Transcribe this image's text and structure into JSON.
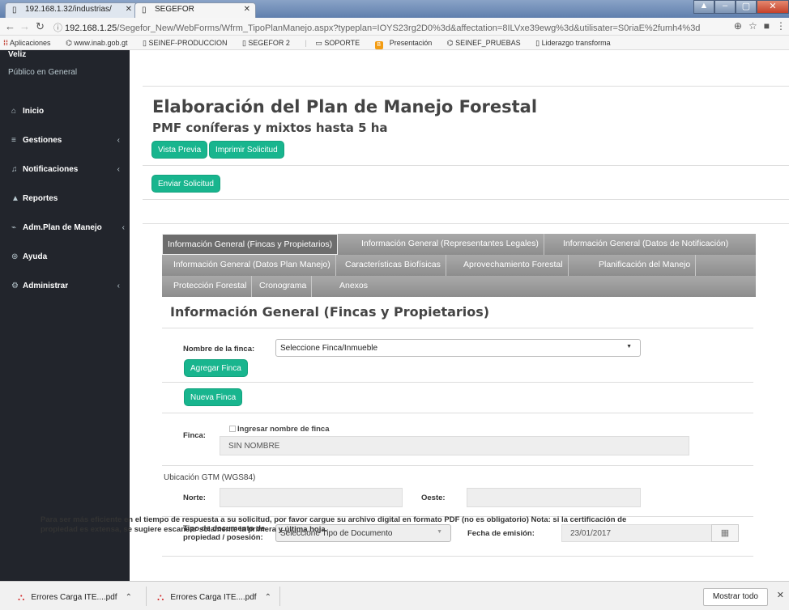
{
  "browser": {
    "tabs": [
      {
        "title": "192.168.1.32/industrias/",
        "active": false
      },
      {
        "title": "SEGEFOR",
        "active": true
      }
    ],
    "url": {
      "host": "192.168.1.25",
      "path": "/Segefor_New/WebForms/Wfrm_TipoPlanManejo.aspx?typeplan=IOYS23rg2D0%3d&affectation=8ILVxe39ewg%3d&utilisater=S0riaE%2fumh4%3d"
    },
    "bookmarks": [
      "Aplicaciones",
      "www.inab.gob.gt",
      "SEINEF-PRODUCCION",
      "SEGEFOR 2",
      "SOPORTE",
      "Presentación",
      "SEINEF_PRUEBAS",
      "Liderazgo transforma"
    ]
  },
  "sidebar": {
    "user_name": "Veliz",
    "user_role": "Público en General",
    "items": [
      {
        "label": "Inicio",
        "icon": "home-icon",
        "glyph": "⌂",
        "submenu": false
      },
      {
        "label": "Gestiones",
        "icon": "list-icon",
        "glyph": "≡",
        "submenu": true
      },
      {
        "label": "Notificaciones",
        "icon": "bell-icon",
        "glyph": "♫",
        "submenu": true
      },
      {
        "label": "Reportes",
        "icon": "print-icon",
        "glyph": "▲",
        "submenu": false
      },
      {
        "label": "Adm.Plan de Manejo",
        "icon": "chart-icon",
        "glyph": "⌁",
        "submenu": true
      },
      {
        "label": "Ayuda",
        "icon": "help-icon",
        "glyph": "⊛",
        "submenu": false
      },
      {
        "label": "Administrar",
        "icon": "settings-icon",
        "glyph": "⚙",
        "submenu": true
      }
    ],
    "chevron": "‹"
  },
  "main": {
    "title": "Elaboración del Plan de Manejo Forestal",
    "subtitle": "PMF coníferas y mixtos hasta 5 ha",
    "btn_preview": "Vista Previa",
    "btn_print": "Imprimir Solicitud",
    "btn_send": "Enviar Solicitud",
    "tabs_row1": [
      "Información General (Fincas y Propietarios)",
      "Información General (Representantes Legales)",
      "Información General (Datos de Notificación)"
    ],
    "tabs_row2": [
      "Información General (Datos Plan Manejo)",
      "Características Biofísicas",
      "Aprovechamiento Forestal",
      "Planificación del Manejo"
    ],
    "tabs_row3": [
      "Protección Forestal",
      "Cronograma",
      "Anexos"
    ],
    "section_title": "Información General (Fincas y Propietarios)",
    "finca_label": "Nombre de la finca:",
    "finca_select": "Seleccione Finca/Inmueble",
    "btn_add_finca": "Agregar Finca",
    "btn_new_finca": "Nueva Finca",
    "finca_field_label": "Finca:",
    "finca_checkbox_label": "Ingresar nombre de finca",
    "finca_value": "SIN NOMBRE",
    "gtm_label": "Ubicación GTM (WGS84)",
    "norte_label": "Norte:",
    "oeste_label": "Oeste:",
    "tipo_doc_label": "Tipo de documento de propiedad / posesión:",
    "tipo_doc_select": "Seleccione Tipo de Documento",
    "fecha_label": "Fecha de emisión:",
    "fecha_value": "23/01/2017",
    "note": "Para ser más eficiente en el tiempo de respuesta a su solicitud, por favor cargue su archivo digital en formato PDF (no es obligatorio) Nota: si la certificación de propiedad es extensa, se sugiere escanear solamente la primera y última hoja."
  },
  "downloads": {
    "items": [
      "Errores Carga ITE....pdf",
      "Errores Carga ITE....pdf"
    ],
    "show_all": "Mostrar todo"
  },
  "colors": {
    "accent": "#18b58e",
    "sidebar": "#22252c"
  }
}
